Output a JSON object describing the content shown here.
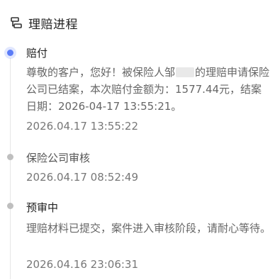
{
  "header": {
    "title": "理赔进程",
    "icon": "process-flow-icon"
  },
  "timeline": {
    "accent_color": "#5b7cf7",
    "inactive_color": "#bfbfbf",
    "steps": [
      {
        "title": "赔付",
        "desc_before_mask": "尊敬的客户，您好！被保险人邹",
        "desc_after_mask": "的理赔申请保险公司已结案，本次赔付金额为：1577.44元，结案日期：2026-04-17 13:55:21。",
        "time": "2026.04.17 13:55:22",
        "active": true
      },
      {
        "title": "保险公司审核",
        "time": "2026.04.17 08:52:49",
        "active": false
      },
      {
        "title": "预审中",
        "desc": "理赔材料已提交，案件进入审核阶段，请耐心等待。",
        "time": "2026.04.16 23:06:31",
        "active": false
      }
    ]
  }
}
